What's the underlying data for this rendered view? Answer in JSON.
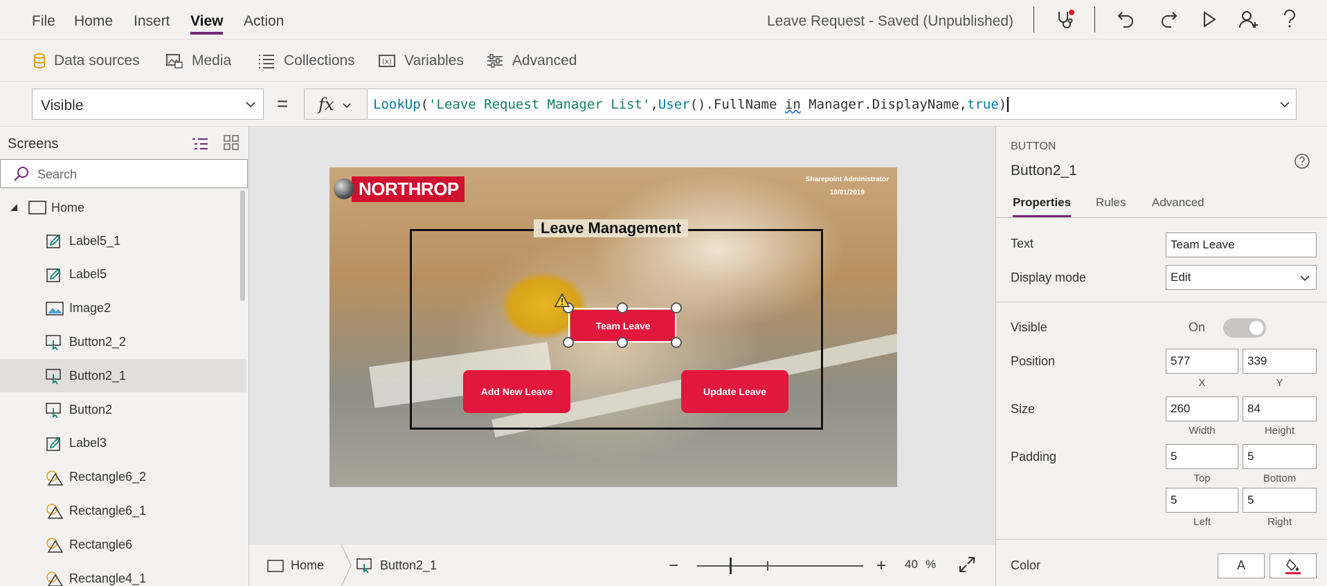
{
  "menu": {
    "items": [
      "File",
      "Home",
      "Insert",
      "View",
      "Action"
    ],
    "active": "View",
    "app_title": "Leave Request - Saved (Unpublished)"
  },
  "ribbon": {
    "items": [
      "Data sources",
      "Media",
      "Collections",
      "Variables",
      "Advanced"
    ]
  },
  "formula_bar": {
    "property": "Visible",
    "equals": "=",
    "fx": "fx",
    "formula_parts": {
      "fn1": "LookUp",
      "open1": "(",
      "str1": "'Leave Request Manager List'",
      "comma1": ",",
      "fn2": "User",
      "rest1": "().FullName ",
      "kw": "in",
      "rest2": " Manager.DisplayName,",
      "fn3": "true",
      "close": ")"
    }
  },
  "tree": {
    "title": "Screens",
    "search_placeholder": "Search",
    "root": "Home",
    "items": [
      {
        "label": "Label5_1",
        "icon": "label-icon"
      },
      {
        "label": "Label5",
        "icon": "label-icon"
      },
      {
        "label": "Image2",
        "icon": "image-icon"
      },
      {
        "label": "Button2_2",
        "icon": "button-icon"
      },
      {
        "label": "Button2_1",
        "icon": "button-icon",
        "selected": true
      },
      {
        "label": "Button2",
        "icon": "button-icon"
      },
      {
        "label": "Label3",
        "icon": "label-icon"
      },
      {
        "label": "Rectangle6_2",
        "icon": "shape-icon"
      },
      {
        "label": "Rectangle6_1",
        "icon": "shape-icon"
      },
      {
        "label": "Rectangle6",
        "icon": "shape-icon"
      },
      {
        "label": "Rectangle4_1",
        "icon": "shape-icon"
      }
    ]
  },
  "canvas": {
    "logo_text": "NORTHROP",
    "admin_line1": "Sharepoint Administrator",
    "admin_line2": "10/01/2019",
    "frame_title": "Leave Management",
    "btn_team": "Team Leave",
    "btn_add": "Add New Leave",
    "btn_update": "Update Leave"
  },
  "status": {
    "screen": "Home",
    "control": "Button2_1",
    "zoom": "40",
    "zoom_unit": "%"
  },
  "properties": {
    "type": "BUTTON",
    "name": "Button2_1",
    "tabs": [
      "Properties",
      "Rules",
      "Advanced"
    ],
    "active_tab": "Properties",
    "text_label": "Text",
    "text_value": "Team Leave",
    "display_mode_label": "Display mode",
    "display_mode_value": "Edit",
    "visible_label": "Visible",
    "visible_value": "On",
    "position_label": "Position",
    "x": "577",
    "y": "339",
    "x_label": "X",
    "y_label": "Y",
    "size_label": "Size",
    "width": "260",
    "height": "84",
    "width_label": "Width",
    "height_label": "Height",
    "padding_label": "Padding",
    "pad_top": "5",
    "pad_bottom": "5",
    "pad_left": "5",
    "pad_right": "5",
    "top_label": "Top",
    "bottom_label": "Bottom",
    "left_label": "Left",
    "right_label": "Right",
    "color_label": "Color",
    "color_text_glyph": "A"
  },
  "colors": {
    "accent": "#742774",
    "app_red": "#e2173d",
    "notification": "#e81123"
  }
}
